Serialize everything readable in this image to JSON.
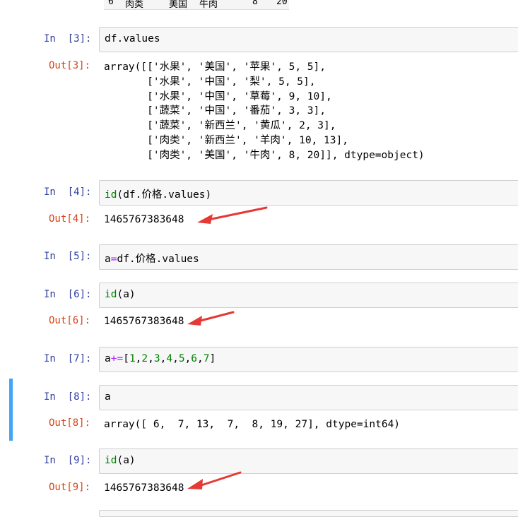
{
  "top_row": {
    "index": "6",
    "category": "肉类",
    "country": "美国",
    "name": "牛肉",
    "price": "8",
    "amount": "20"
  },
  "cells": [
    {
      "in_prompt": "In  [3]:",
      "code": "df.values",
      "out_prompt": "Out[3]:",
      "output": "array([['水果', '美国', '苹果', 5, 5],\n       ['水果', '中国', '梨', 5, 5],\n       ['水果', '中国', '草莓', 9, 10],\n       ['蔬菜', '中国', '番茄', 3, 3],\n       ['蔬菜', '新西兰', '黄瓜', 2, 3],\n       ['肉类', '新西兰', '羊肉', 10, 13],\n       ['肉类', '美国', '牛肉', 8, 20]], dtype=object)"
    },
    {
      "in_prompt": "In  [4]:",
      "code_fn": "id",
      "code_rest": "(df.价格.values)",
      "out_prompt": "Out[4]:",
      "output": "1465767383648"
    },
    {
      "in_prompt": "In  [5]:",
      "code_a": "a",
      "code_op": "=",
      "code_rest": "df.价格.values"
    },
    {
      "in_prompt": "In  [6]:",
      "code_fn": "id",
      "code_rest": "(a)",
      "out_prompt": "Out[6]:",
      "output": "1465767383648"
    },
    {
      "in_prompt": "In  [7]:",
      "code_a": "a",
      "code_op": "+=",
      "code_lb": "[",
      "code_nums": [
        "1",
        "2",
        "3",
        "4",
        "5",
        "6",
        "7"
      ],
      "code_rb": "]"
    },
    {
      "in_prompt": "In  [8]:",
      "code": "a",
      "out_prompt": "Out[8]:",
      "output": "array([ 6,  7, 13,  7,  8, 19, 27], dtype=int64)"
    },
    {
      "in_prompt": "In  [9]:",
      "code_fn": "id",
      "code_rest": "(a)",
      "out_prompt": "Out[9]:",
      "output": "1465767383648"
    }
  ],
  "colors": {
    "in_prompt": "#303f9f",
    "out_prompt": "#d84315",
    "selected_bar": "#42a5f5",
    "arrow": "#e53935"
  },
  "annotations": [
    "red-arrow",
    "red-arrow",
    "red-arrow"
  ]
}
